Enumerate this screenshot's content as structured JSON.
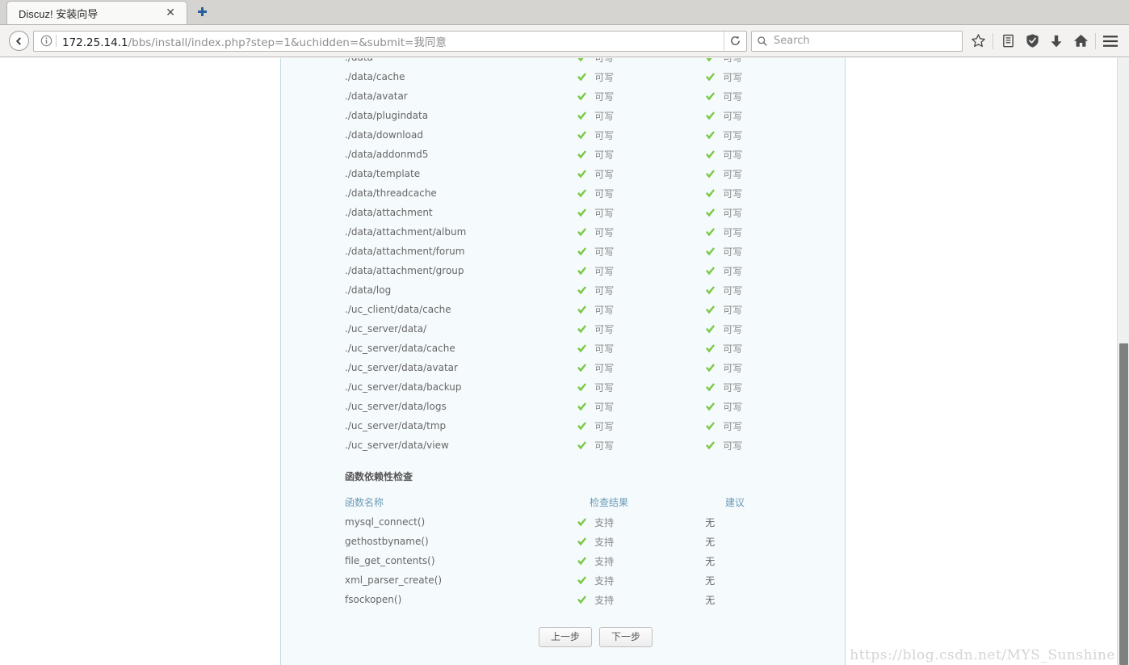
{
  "browser": {
    "tab": {
      "title": "Discuz! 安装向导",
      "close_label": "✕",
      "newtab_label": "+"
    },
    "nav": {
      "back_icon": "back-arrow-icon",
      "info_icon": "info-icon",
      "url_domain": "172.25.14.1",
      "url_path": "/bbs/install/index.php?step=1&uchidden=&submit=我同意",
      "reload_icon": "reload-icon"
    },
    "search": {
      "placeholder": "Search",
      "icon": "search-icon"
    },
    "toolbar_icons": [
      "bookmark-star-icon",
      "reader-list-icon",
      "shield-icon",
      "downloads-icon",
      "home-icon",
      "hamburger-menu-icon"
    ]
  },
  "page": {
    "dir_rows": [
      {
        "path": "./data",
        "result": "可写",
        "advice": "可写"
      },
      {
        "path": "./data/cache",
        "result": "可写",
        "advice": "可写"
      },
      {
        "path": "./data/avatar",
        "result": "可写",
        "advice": "可写"
      },
      {
        "path": "./data/plugindata",
        "result": "可写",
        "advice": "可写"
      },
      {
        "path": "./data/download",
        "result": "可写",
        "advice": "可写"
      },
      {
        "path": "./data/addonmd5",
        "result": "可写",
        "advice": "可写"
      },
      {
        "path": "./data/template",
        "result": "可写",
        "advice": "可写"
      },
      {
        "path": "./data/threadcache",
        "result": "可写",
        "advice": "可写"
      },
      {
        "path": "./data/attachment",
        "result": "可写",
        "advice": "可写"
      },
      {
        "path": "./data/attachment/album",
        "result": "可写",
        "advice": "可写"
      },
      {
        "path": "./data/attachment/forum",
        "result": "可写",
        "advice": "可写"
      },
      {
        "path": "./data/attachment/group",
        "result": "可写",
        "advice": "可写"
      },
      {
        "path": "./data/log",
        "result": "可写",
        "advice": "可写"
      },
      {
        "path": "./uc_client/data/cache",
        "result": "可写",
        "advice": "可写"
      },
      {
        "path": "./uc_server/data/",
        "result": "可写",
        "advice": "可写"
      },
      {
        "path": "./uc_server/data/cache",
        "result": "可写",
        "advice": "可写"
      },
      {
        "path": "./uc_server/data/avatar",
        "result": "可写",
        "advice": "可写"
      },
      {
        "path": "./uc_server/data/backup",
        "result": "可写",
        "advice": "可写"
      },
      {
        "path": "./uc_server/data/logs",
        "result": "可写",
        "advice": "可写"
      },
      {
        "path": "./uc_server/data/tmp",
        "result": "可写",
        "advice": "可写"
      },
      {
        "path": "./uc_server/data/view",
        "result": "可写",
        "advice": "可写"
      }
    ],
    "func_section": {
      "title": "函数依赖性检查",
      "headers": {
        "name": "函数名称",
        "result": "检查结果",
        "advice": "建议"
      },
      "rows": [
        {
          "name": "mysql_connect()",
          "result": "支持",
          "advice": "无"
        },
        {
          "name": "gethostbyname()",
          "result": "支持",
          "advice": "无"
        },
        {
          "name": "file_get_contents()",
          "result": "支持",
          "advice": "无"
        },
        {
          "name": "xml_parser_create()",
          "result": "支持",
          "advice": "无"
        },
        {
          "name": "fsockopen()",
          "result": "支持",
          "advice": "无"
        }
      ]
    },
    "buttons": {
      "prev": "上一步",
      "next": "下一步"
    },
    "watermark": "https://blog.csdn.net/MYS_Sunshine",
    "colors": {
      "panel_bg": "#f5fafd",
      "panel_border": "#c3d9e2",
      "header_text": "#6b9ab5",
      "check_green": "#7ac943",
      "body_text": "#666666"
    }
  }
}
